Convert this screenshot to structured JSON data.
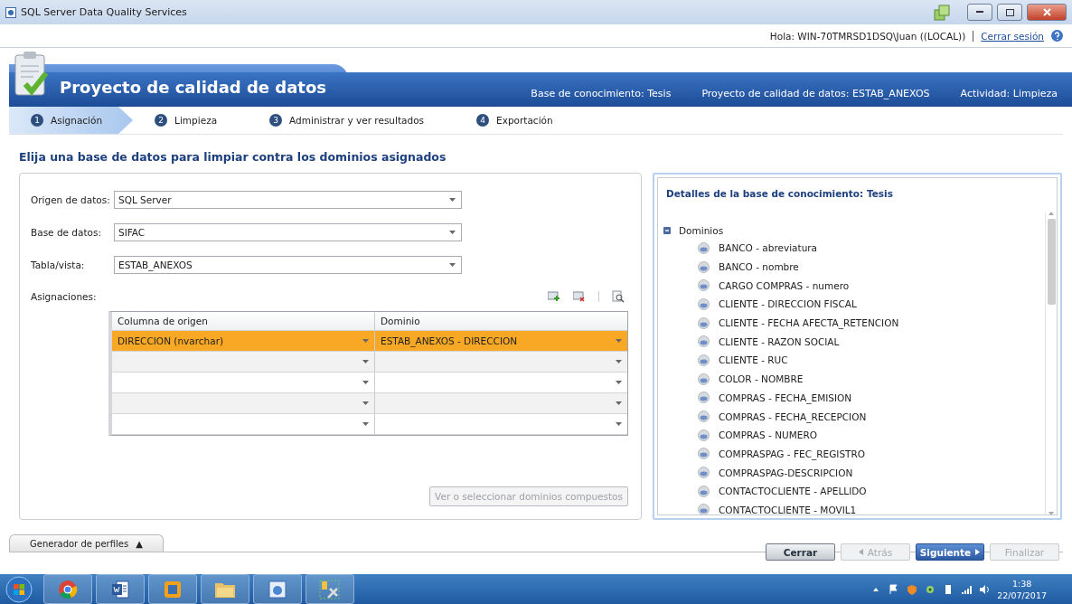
{
  "window": {
    "title": "SQL Server Data Quality Services"
  },
  "user_bar": {
    "greeting": "Hola: WIN-70TMRSD1DSQ\\Juan ((LOCAL))",
    "logout": "Cerrar sesión"
  },
  "header": {
    "title": "Proyecto de calidad de datos",
    "info": [
      "Base de conocimiento: Tesis",
      "Proyecto de calidad de datos: ESTAB_ANEXOS",
      "Actividad: Limpieza"
    ]
  },
  "steps": [
    {
      "number": "1",
      "label": "Asignación",
      "selected": true
    },
    {
      "number": "2",
      "label": "Limpieza",
      "selected": false
    },
    {
      "number": "3",
      "label": "Administrar y ver resultados",
      "selected": false
    },
    {
      "number": "4",
      "label": "Exportación",
      "selected": false
    }
  ],
  "heading": "Elija una base de datos para limpiar contra los dominios asignados",
  "fields": [
    {
      "label": "Origen de datos:",
      "value": "SQL Server"
    },
    {
      "label": "Base de datos:",
      "value": "SIFAC"
    },
    {
      "label": "Tabla/vista:",
      "value": "ESTAB_ANEXOS"
    }
  ],
  "mappings": {
    "label": "Asignaciones:",
    "columns": [
      "Columna de origen",
      "Dominio"
    ],
    "rows": [
      {
        "selected": true,
        "cells": [
          "DIRECCION (nvarchar)",
          "ESTAB_ANEXOS - DIRECCION"
        ]
      },
      {
        "selected": false
      },
      {
        "selected": false
      },
      {
        "selected": false
      },
      {
        "selected": false
      }
    ],
    "composite_button": {
      "label": "Ver o seleccionar dominios compuestos",
      "disabled": true
    }
  },
  "details": {
    "title": "Detalles de la base de conocimiento: Tesis",
    "tree": [
      {
        "label": "Dominios",
        "expanded": true,
        "children": [
          {
            "label": "BANCO - abreviatura"
          },
          {
            "label": "BANCO - nombre"
          },
          {
            "label": "CARGO COMPRAS - numero"
          },
          {
            "label": "CLIENTE - DIRECCION FISCAL"
          },
          {
            "label": "CLIENTE - FECHA AFECTA_RETENCION"
          },
          {
            "label": "CLIENTE - RAZON SOCIAL"
          },
          {
            "label": "CLIENTE - RUC"
          },
          {
            "label": "COLOR - NOMBRE"
          },
          {
            "label": "COMPRAS - FECHA_EMISION"
          },
          {
            "label": "COMPRAS - FECHA_RECEPCION"
          },
          {
            "label": "COMPRAS - NUMERO"
          },
          {
            "label": "COMPRASPAG - FEC_REGISTRO"
          },
          {
            "label": "COMPRASPAG-DESCRIPCION"
          },
          {
            "label": "CONTACTOCLIENTE - APELLIDO"
          },
          {
            "label": "CONTACTOCLIENTE - MOVIL1"
          }
        ]
      }
    ]
  },
  "profiler_tab": {
    "label": "Generador de perfiles",
    "glyph": "▲"
  },
  "buttons": [
    {
      "kind": "normal",
      "label": "Cerrar",
      "disabled": false
    },
    {
      "kind": "back",
      "label": "Atrás",
      "disabled": true
    },
    {
      "kind": "primary",
      "label": "Siguiente",
      "disabled": false
    },
    {
      "kind": "normal",
      "label": "Finalizar",
      "disabled": true
    }
  ],
  "taskbar": {
    "apps": [
      {
        "kind": "chrome"
      },
      {
        "kind": "word"
      },
      {
        "kind": "vm"
      },
      {
        "kind": "folder"
      },
      {
        "kind": "dqs"
      },
      {
        "kind": "tool"
      }
    ],
    "time": "1:38",
    "date": "22/07/2017"
  }
}
